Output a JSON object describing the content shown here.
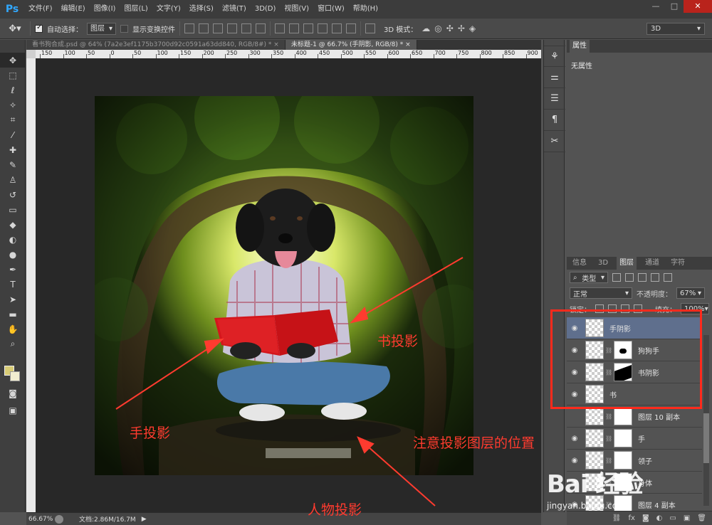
{
  "app": {
    "logo": "Ps"
  },
  "menu": [
    "文件(F)",
    "编辑(E)",
    "图像(I)",
    "图层(L)",
    "文字(Y)",
    "选择(S)",
    "滤镜(T)",
    "3D(D)",
    "视图(V)",
    "窗口(W)",
    "帮助(H)"
  ],
  "window_controls": {
    "minimize": "—",
    "restore": "□",
    "close": "✕"
  },
  "options": {
    "auto_select_label": "自动选择：",
    "auto_select_checked": true,
    "target_value": "图层",
    "show_transform_label": "显示变换控件",
    "show_transform_checked": false,
    "mode_3d_label": "3D 模式：",
    "workspace": "3D"
  },
  "tabs": [
    {
      "label": "看书狗合成.psd @ 64% (7a2e3ef1175b3700d92c0591a63dd840, RGB/8#) *",
      "active": false,
      "close": "×"
    },
    {
      "label": "未标题-1 @ 66.7% (手阴影, RGB/8) *",
      "active": true,
      "close": "×"
    }
  ],
  "ruler_h": [
    "150",
    "100",
    "50",
    "0",
    "50",
    "100",
    "150",
    "200",
    "250",
    "300",
    "350",
    "400",
    "450",
    "500",
    "550",
    "600",
    "650",
    "700",
    "750",
    "800",
    "850",
    "900"
  ],
  "annotations": {
    "book_shadow": "书投影",
    "hand_shadow": "手投影",
    "layer_position": "注意投影图层的位置",
    "person_shadow": "人物投影"
  },
  "status": {
    "zoom": "66.67%",
    "doc": "文档:2.86M/16.7M",
    "arrow": "▶"
  },
  "properties": {
    "tab": "属性",
    "empty": "无属性"
  },
  "layers_panel": {
    "tabs": [
      "信息",
      "3D",
      "图层",
      "通道",
      "字符"
    ],
    "active_tab": "图层",
    "filter_type": "类型",
    "blend_mode": "正常",
    "opacity_label": "不透明度：",
    "opacity_value": "67%",
    "lock_label": "锁定：",
    "fill_label": "填充：",
    "fill_value": "100%",
    "layers": [
      {
        "name": "手阴影",
        "selected": true,
        "mask": "none",
        "visible": true
      },
      {
        "name": "狗狗手",
        "selected": false,
        "mask": "dog-hand",
        "visible": true
      },
      {
        "name": "书阴影",
        "selected": false,
        "mask": "book-shadow",
        "visible": true
      },
      {
        "name": "书",
        "selected": false,
        "mask": "none",
        "visible": true
      },
      {
        "name": "图层 10 副本",
        "selected": false,
        "mask": "plain",
        "visible": false
      },
      {
        "name": "手",
        "selected": false,
        "mask": "plain",
        "visible": true
      },
      {
        "name": "领子",
        "selected": false,
        "mask": "plain",
        "visible": true
      },
      {
        "name": "身体",
        "selected": false,
        "mask": "plain",
        "visible": true
      },
      {
        "name": "图层 4 副本",
        "selected": false,
        "mask": "plain",
        "visible": true
      }
    ]
  },
  "watermark": {
    "logo": "Bai 经验",
    "url": "jingyan.baidu.com"
  },
  "colors": {
    "annotation": "#ff3b2f",
    "selection": "#5f6f8d",
    "foreground": "#d8cc75",
    "background": "#f2eed0"
  }
}
